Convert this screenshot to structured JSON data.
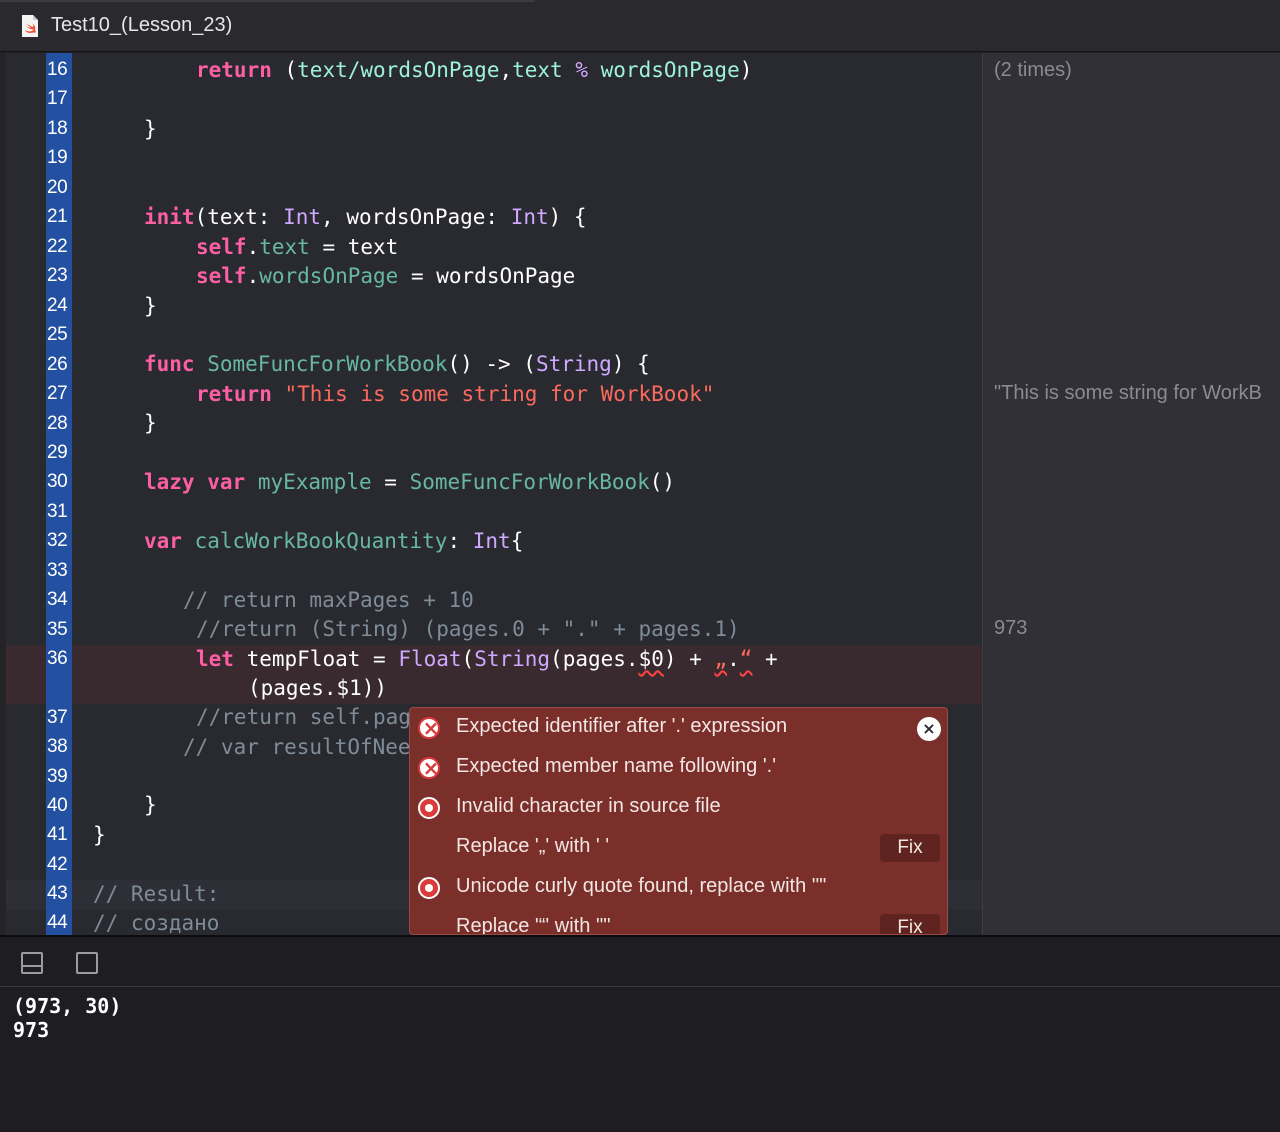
{
  "window": {
    "title": "Test10_(Lesson_23)"
  },
  "editor": {
    "line_numbers": [
      "16",
      "17",
      "18",
      "19",
      "20",
      "21",
      "22",
      "23",
      "24",
      "25",
      "26",
      "27",
      "28",
      "29",
      "30",
      "31",
      "32",
      "33",
      "34",
      "35",
      "36",
      "37",
      "38",
      "39",
      "40",
      "41",
      "42",
      "43",
      "44"
    ],
    "lines": {
      "l16": [
        "return",
        " (",
        "text",
        "/",
        "wordsOnPage",
        ",",
        "text",
        " % ",
        "wordsOnPage",
        ")"
      ],
      "l18": "}",
      "l21": [
        "init",
        "(text: ",
        "Int",
        ", wordsOnPage: ",
        "Int",
        ") {"
      ],
      "l22": [
        "self",
        ".",
        "text",
        " = text"
      ],
      "l23": [
        "self",
        ".",
        "wordsOnPage",
        " = wordsOnPage"
      ],
      "l24": "}",
      "l26": [
        "func",
        " ",
        "SomeFuncForWorkBook",
        "() -> (",
        "String",
        ") {"
      ],
      "l27": [
        "return",
        " ",
        "\"This is some string for WorkBook\""
      ],
      "l28": "}",
      "l30": [
        "lazy",
        " ",
        "var",
        " ",
        "myExample",
        " = ",
        "SomeFuncForWorkBook",
        "()"
      ],
      "l32": [
        "var",
        " ",
        "calcWorkBookQuantity",
        ": ",
        "Int",
        "{"
      ],
      "l34": "// return maxPages + 10",
      "l35": "//return (String) (pages.0 + \".\" + pages.1)",
      "l36a": [
        "let",
        " tempFloat = ",
        "Float",
        "(",
        "String",
        "(pages.",
        "$0",
        ") + ",
        "„",
        ".",
        "“",
        " +"
      ],
      "l36b": "(pages.$1))",
      "l37": "//return self.pag",
      "l38": "// var resultOfNee",
      "l40": "}",
      "l41": "}",
      "l43": "// Result:",
      "l44": "// создано"
    }
  },
  "results": {
    "r16": "(2 times)",
    "r27": "\"This is some string for WorkB",
    "r35": "973"
  },
  "issues": {
    "items": [
      {
        "icon": "error-x-icon",
        "text": "Expected identifier after '.' expression"
      },
      {
        "icon": "error-x-icon",
        "text": "Expected member name following '.'"
      },
      {
        "icon": "error-stop-icon",
        "text": "Invalid character in source file"
      },
      {
        "icon": "",
        "text": "Replace '„' with ' '",
        "fix": "Fix"
      },
      {
        "icon": "error-stop-icon",
        "text": "Unicode curly quote found, replace with '\"'"
      },
      {
        "icon": "",
        "text": "Replace '“' with '\"'",
        "fix": "Fix"
      }
    ],
    "close": "×"
  },
  "console": {
    "lines": [
      "(973, 30)",
      "973"
    ]
  },
  "colors": {
    "keyword": "#fc5fa3",
    "type": "#d0a8ff",
    "function": "#67b7a4",
    "property": "#9ef1dd",
    "string": "#fc6a5d",
    "comment": "#7f8c98",
    "gutter": "#2350a0",
    "error_popup": "#7a2f2b"
  }
}
